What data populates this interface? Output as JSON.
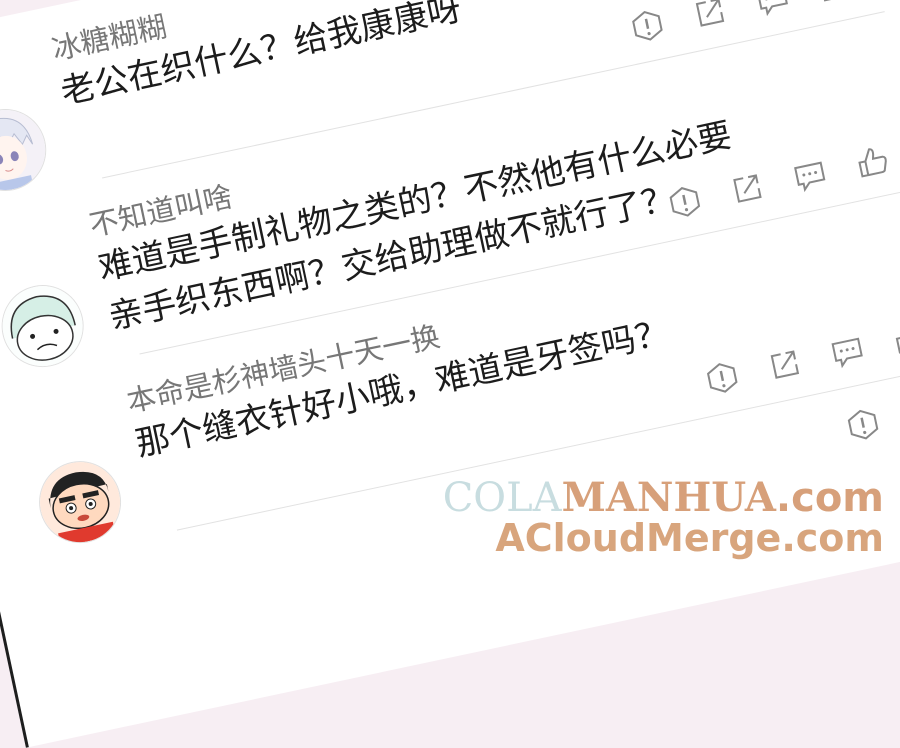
{
  "comments": [
    {
      "username": "冰糖糊糊",
      "lines": [
        "老公在织什么？给我康康呀"
      ],
      "avatar": "anime-boy-avatar"
    },
    {
      "username": "不知道叫啥",
      "lines": [
        "难道是手制礼物之类的？不然他有什么必要",
        "亲手织东西啊？交给助理做不就行了？"
      ],
      "avatar": "doodle-face-avatar"
    },
    {
      "username": "本命是杉神墙头十天一换",
      "lines": [
        "那个缝衣针好小哦，难道是牙签吗？"
      ],
      "avatar": "crayon-shin-chan-avatar"
    }
  ],
  "icons": [
    "warning-icon",
    "share-icon",
    "comment-icon",
    "like-icon"
  ],
  "watermark": {
    "line1_cola": "COLA",
    "line1_manhua": "MANHUA",
    "line1_com": ".com",
    "line2": "ACloudMerge.com"
  },
  "colors": {
    "accent_watermark": "#d7a07a",
    "text": "#1c1c1c",
    "username": "#777777"
  }
}
